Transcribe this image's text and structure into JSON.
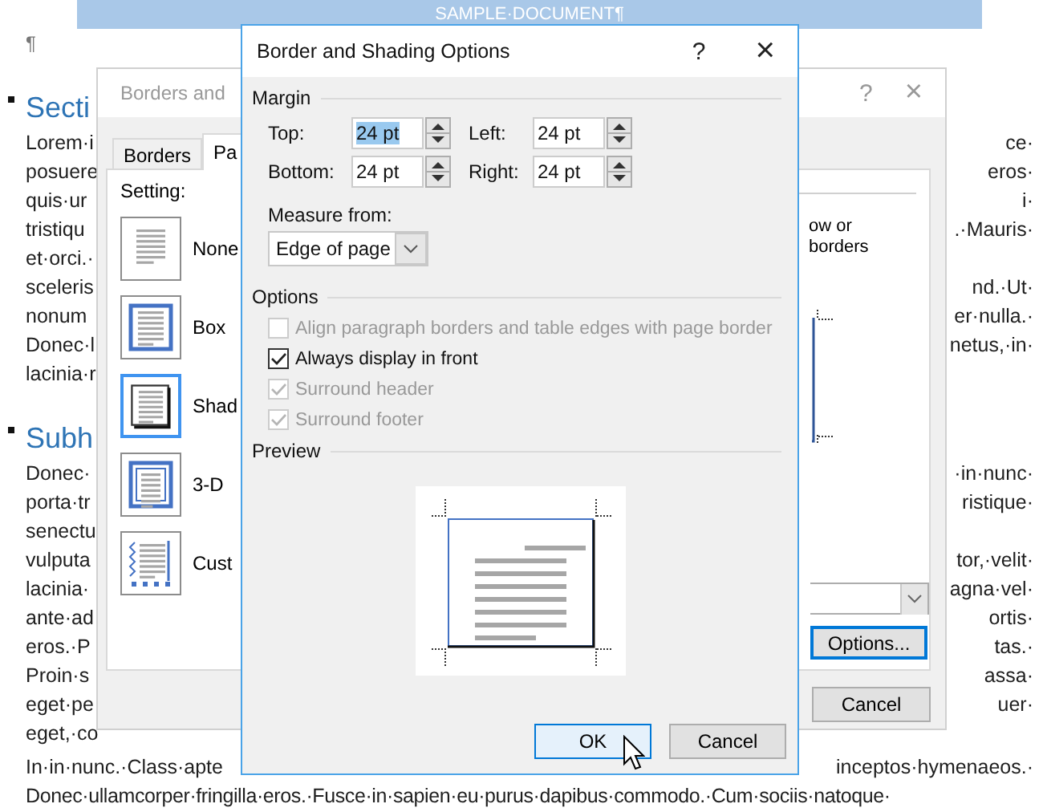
{
  "document": {
    "header_bar": "SAMPLE·DOCUMENT¶",
    "pilcrow": "¶",
    "blocks": [
      {
        "kind": "heading",
        "left": "Secti"
      },
      {
        "kind": "line",
        "left": "Lorem·i",
        "right": "ce·"
      },
      {
        "kind": "line",
        "left": "posuere",
        "right": "eros·"
      },
      {
        "kind": "line",
        "left": "quis·ur",
        "right": "i·"
      },
      {
        "kind": "line",
        "left": "tristiqu",
        "right": ".·Mauris·"
      },
      {
        "kind": "line",
        "left": "et·orci.·"
      },
      {
        "kind": "line",
        "left": "sceleris",
        "right": "nd.·Ut·"
      },
      {
        "kind": "line",
        "left": "nonum",
        "right": "er·nulla.·"
      },
      {
        "kind": "line",
        "left": "Donec·l",
        "right": "netus,·in·"
      },
      {
        "kind": "line",
        "left": "lacinia·r"
      },
      {
        "kind": "heading",
        "left": "Subh"
      },
      {
        "kind": "line",
        "left": "Donec·",
        "right": "·in·nunc·"
      },
      {
        "kind": "line",
        "left": "porta·tr",
        "right": "ristique·"
      },
      {
        "kind": "line",
        "left": "senectu"
      },
      {
        "kind": "line",
        "left": "vulputa",
        "right": "tor,·velit·"
      },
      {
        "kind": "line",
        "left": "lacinia·",
        "right": "agna·vel·"
      },
      {
        "kind": "line",
        "left": "ante·ad",
        "right": "ortis·"
      },
      {
        "kind": "line",
        "left": "eros.·P",
        "right": "tas.·"
      },
      {
        "kind": "line",
        "left": "Proin·s",
        "right": "assa·"
      },
      {
        "kind": "line",
        "left": "eget·pe",
        "right": "uer·"
      },
      {
        "kind": "line",
        "left": "eget,·co"
      },
      {
        "kind": "gapline",
        "left": "In·in·nunc.·Class·apte",
        "right": "inceptos·hymenaeos.·"
      },
      {
        "kind": "fullline",
        "left": "Donec·ullamcorper·fringilla·eros.·Fusce·in·sapien·eu·purus·dapibus·commodo.·Cum·sociis·natoque·"
      }
    ]
  },
  "back_dialog": {
    "title": "Borders and",
    "help": "?",
    "close": "×",
    "tabs": [
      {
        "label": "Borders",
        "selected": false
      },
      {
        "label": "Pa",
        "selected": true
      }
    ],
    "setting_label": "Setting:",
    "settings": [
      {
        "label": "None",
        "kind": "none",
        "selected": false
      },
      {
        "label": "Box",
        "kind": "box",
        "selected": false
      },
      {
        "label": "Shad",
        "kind": "shadow",
        "selected": true
      },
      {
        "label": "3-D",
        "kind": "threed",
        "selected": false
      },
      {
        "label": "Cust",
        "kind": "custom",
        "selected": false
      }
    ],
    "note_lines": [
      "ow or",
      "borders"
    ],
    "options_button": "Options...",
    "cancel_button": "Cancel"
  },
  "dialog": {
    "title": "Border and Shading Options",
    "help": "?",
    "close": "×",
    "margin_label": "Margin",
    "margins": [
      {
        "label": "Top:",
        "value": "24 pt",
        "highlighted": true
      },
      {
        "label": "Left:",
        "value": "24 pt",
        "highlighted": false
      },
      {
        "label": "Bottom:",
        "value": "24 pt",
        "highlighted": false
      },
      {
        "label": "Right:",
        "value": "24 pt",
        "highlighted": false
      }
    ],
    "measure_label": "Measure from:",
    "measure_value": "Edge of page",
    "options_label": "Options",
    "options": [
      {
        "label": "Align paragraph borders and table edges with page border",
        "checked": false,
        "disabled": true
      },
      {
        "label": "Always display in front",
        "checked": true,
        "disabled": false
      },
      {
        "label": "Surround header",
        "checked": true,
        "disabled": true
      },
      {
        "label": "Surround footer",
        "checked": true,
        "disabled": true
      }
    ],
    "preview_label": "Preview",
    "ok_button": "OK",
    "cancel_button": "Cancel"
  }
}
